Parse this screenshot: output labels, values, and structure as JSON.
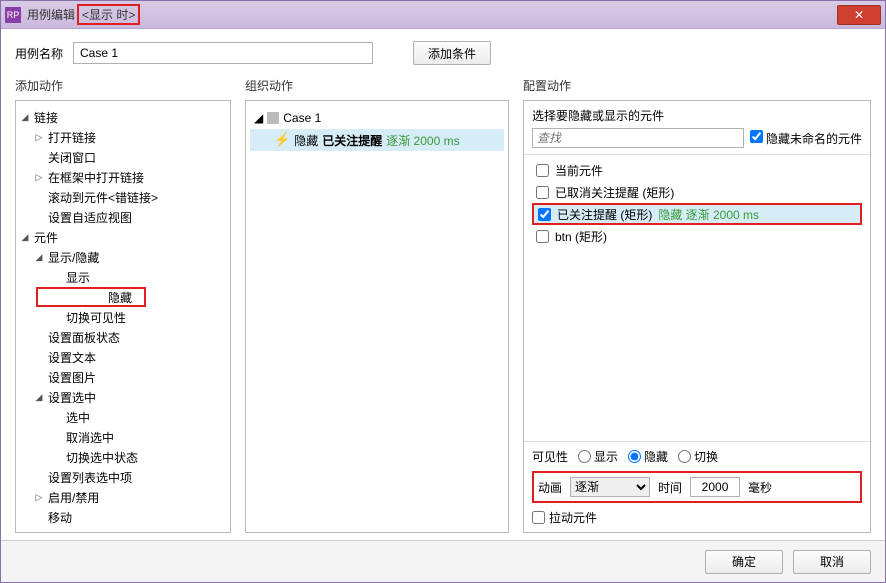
{
  "titlebar": {
    "prefix": "用例编辑",
    "highlight": "<显示 时>",
    "close": "✕"
  },
  "name_row": {
    "label": "用例名称",
    "value": "Case 1",
    "add_condition": "添加条件"
  },
  "columns": {
    "left_header": "添加动作",
    "mid_header": "组织动作",
    "right_header": "配置动作"
  },
  "action_tree": {
    "groups": [
      {
        "label": "链接",
        "items": [
          "打开链接",
          "关闭窗口",
          "在框架中打开链接",
          "滚动到元件<错链接>",
          "设置自适应视图"
        ]
      },
      {
        "label": "元件",
        "subgroups": [
          {
            "label": "显示/隐藏",
            "items": [
              "显示",
              "隐藏",
              "切换可见性"
            ]
          }
        ],
        "items": [
          "设置面板状态",
          "设置文本",
          "设置图片"
        ],
        "subgroups2": [
          {
            "label": "设置选中",
            "items": [
              "选中",
              "取消选中",
              "切换选中状态"
            ]
          }
        ],
        "items_after": [
          "设置列表选中项",
          "启用/禁用",
          "移动"
        ]
      }
    ],
    "highlight_item": "隐藏"
  },
  "organize": {
    "case_label": "Case 1",
    "action_prefix": "隐藏",
    "action_bold": "已关注提醒",
    "action_green": "逐渐 2000 ms"
  },
  "config": {
    "select_label": "选择要隐藏或显示的元件",
    "search_placeholder": "查找",
    "hide_unnamed": "隐藏未命名的元件",
    "elements": [
      {
        "checked": false,
        "label": "当前元件",
        "extra": ""
      },
      {
        "checked": false,
        "label": "已取消关注提醒 (矩形)",
        "extra": ""
      },
      {
        "checked": true,
        "label": "已关注提醒 (矩形)",
        "extra": "隐藏 逐渐 2000 ms",
        "selected": true,
        "highlight": true
      },
      {
        "checked": false,
        "label": "btn (矩形)",
        "extra": ""
      }
    ],
    "visibility": {
      "label": "可见性",
      "options": [
        "显示",
        "隐藏",
        "切换"
      ],
      "selected": "隐藏"
    },
    "animation": {
      "label": "动画",
      "type": "逐渐",
      "time_label": "时间",
      "time_value": "2000",
      "unit": "毫秒"
    },
    "drag_label": "拉动元件"
  },
  "footer": {
    "ok": "确定",
    "cancel": "取消"
  }
}
